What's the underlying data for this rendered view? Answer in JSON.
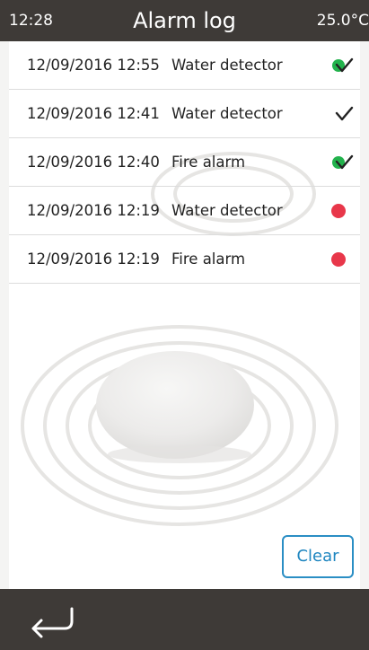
{
  "header": {
    "time": "12:28",
    "title": "Alarm log",
    "temperature": "25.0°C"
  },
  "alarms": [
    {
      "datetime": "12/09/2016 12:55",
      "type": "Water detector",
      "status": "acknowledged-active"
    },
    {
      "datetime": "12/09/2016 12:41",
      "type": "Water detector",
      "status": "acknowledged"
    },
    {
      "datetime": "12/09/2016 12:40",
      "type": "Fire alarm",
      "status": "acknowledged-active"
    },
    {
      "datetime": "12/09/2016 12:19",
      "type": "Water detector",
      "status": "active"
    },
    {
      "datetime": "12/09/2016 12:19",
      "type": "Fire alarm",
      "status": "active"
    }
  ],
  "actions": {
    "clear_label": "Clear"
  },
  "footer": {
    "back_icon": "back-arrow-icon"
  },
  "colors": {
    "bar": "#3e3a37",
    "status_green": "#22b24c",
    "status_red": "#e8374a",
    "accent": "#1f86c0"
  }
}
